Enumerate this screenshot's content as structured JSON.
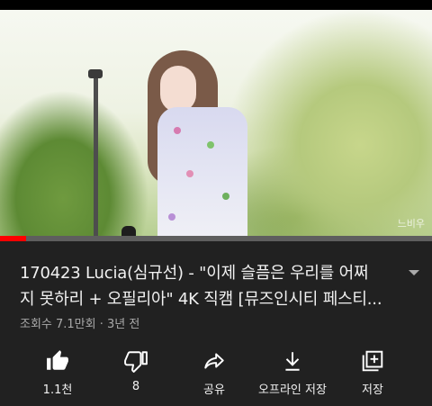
{
  "video": {
    "watermark": "느비우",
    "progress_fraction": 0.06
  },
  "title": {
    "line1": "170423 Lucia(심규선) - \"이제 슬픔은 우리를 어쩌",
    "line2": "지 못하리 + 오필리아\" 4K 직캠 [뮤즈인시티 페스티..."
  },
  "meta": "조회수 7.1만회 · 3년 전",
  "actions": {
    "like_count": "1.1천",
    "dislike_count": "8",
    "share_label": "공유",
    "download_label": "오프라인 저장",
    "save_label": "저장"
  },
  "icons": {
    "like": "thumbs-up-icon",
    "dislike": "thumbs-down-icon",
    "share": "share-icon",
    "download": "download-icon",
    "save": "playlist-add-icon",
    "expand": "chevron-down-icon"
  },
  "colors": {
    "background": "#212121",
    "progress": "#ff0000"
  }
}
